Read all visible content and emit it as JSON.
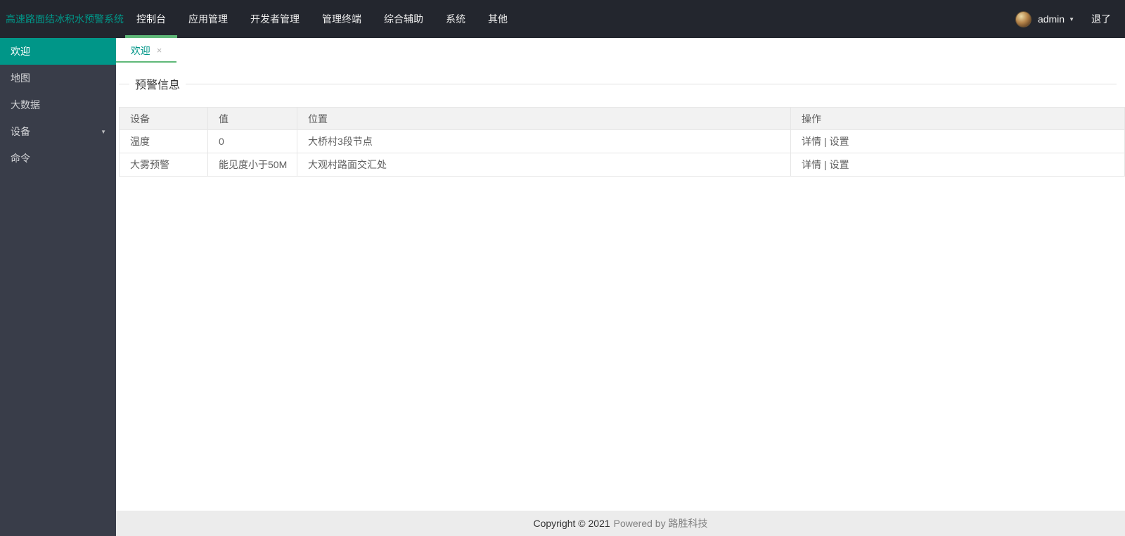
{
  "brand": "高速路面结冰积水预警系统",
  "navbar": {
    "items": [
      {
        "label": "控制台",
        "active": true
      },
      {
        "label": "应用管理"
      },
      {
        "label": "开发者管理"
      },
      {
        "label": "管理终端"
      },
      {
        "label": "综合辅助"
      },
      {
        "label": "系统"
      },
      {
        "label": "其他"
      }
    ],
    "user_name": "admin",
    "logout_label": "退了"
  },
  "sidebar": {
    "items": [
      {
        "label": "欢迎",
        "active": true
      },
      {
        "label": "地图"
      },
      {
        "label": "大数据"
      },
      {
        "label": "设备",
        "has_children": true
      },
      {
        "label": "命令"
      }
    ]
  },
  "tabs": [
    {
      "label": "欢迎",
      "active": true
    }
  ],
  "main": {
    "section_title": "预警信息",
    "table": {
      "headers": [
        "设备",
        "值",
        "位置",
        "操作"
      ],
      "rows": [
        {
          "device": "温度",
          "value": "0",
          "location": "大桥村3段节点",
          "actions": [
            "详情",
            "设置"
          ]
        },
        {
          "device": "大雾预警",
          "value": "能见度小于50M",
          "location": "大观村路面交汇处",
          "actions": [
            "详情",
            "设置"
          ]
        }
      ],
      "action_separator": "|"
    }
  },
  "footer": {
    "copyright": "Copyright © 2021",
    "powered": "Powered by 路胜科技"
  },
  "icons": {
    "caret_down": "▼",
    "close": "×"
  },
  "colors": {
    "navbar_bg": "#23262e",
    "sidebar_bg": "#393d49",
    "accent_teal": "#009688",
    "accent_green": "#5FB878",
    "footer_bg": "#ececec"
  }
}
